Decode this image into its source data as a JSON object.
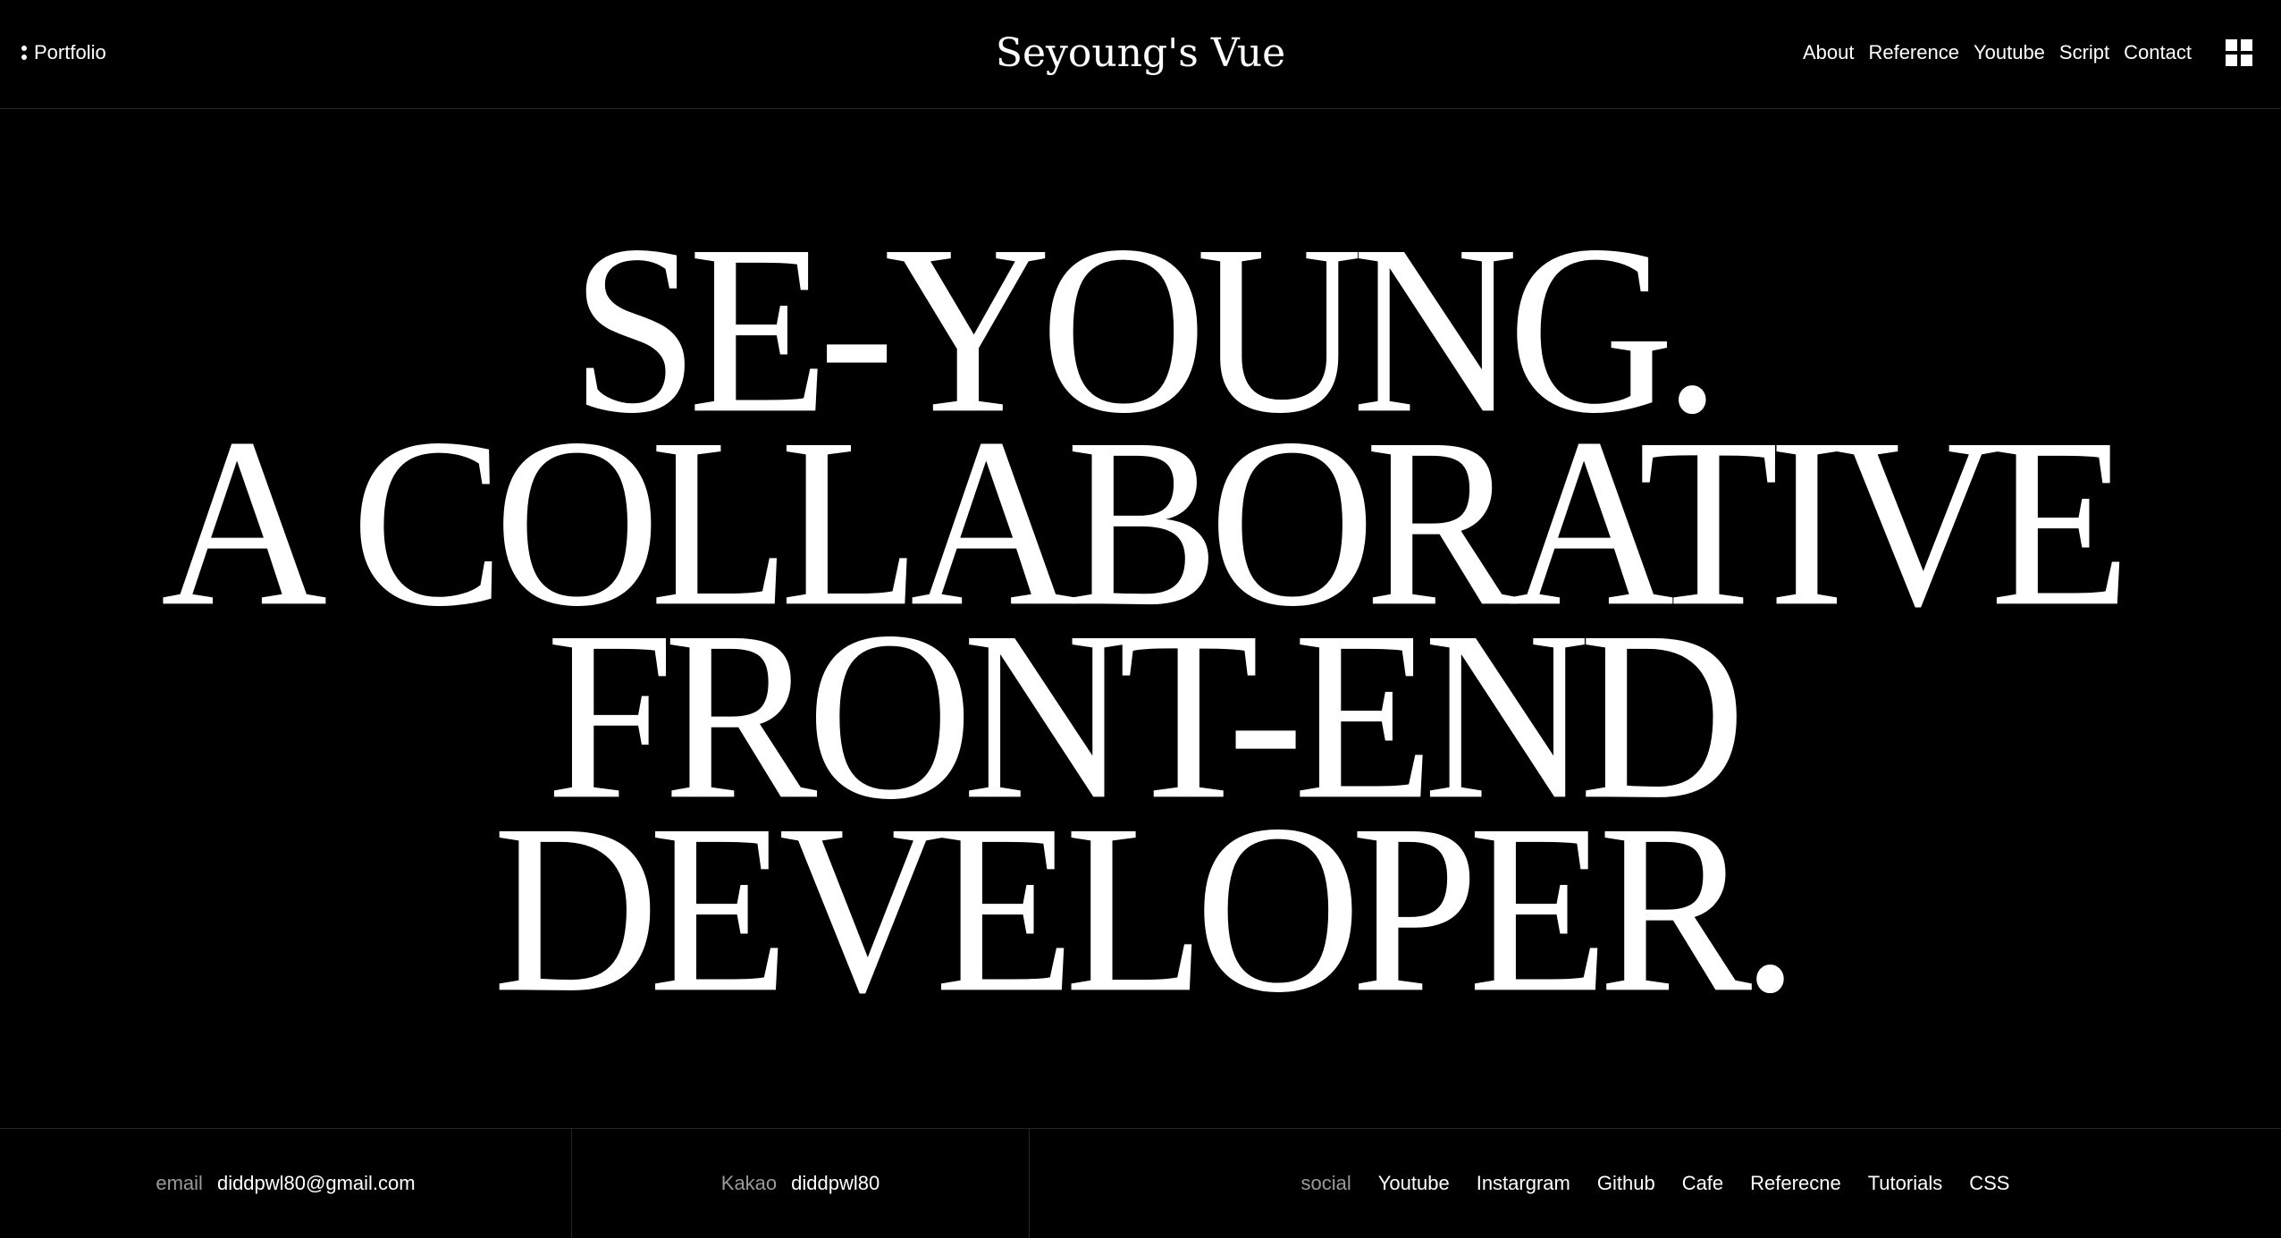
{
  "header": {
    "logo_label": "Portfolio",
    "site_title": "Seyoung's Vue",
    "nav": [
      {
        "label": "About"
      },
      {
        "label": "Reference"
      },
      {
        "label": "Youtube"
      },
      {
        "label": "Script"
      },
      {
        "label": "Contact"
      }
    ],
    "menu_icon": "grid-icon"
  },
  "hero": {
    "lines": [
      "SE-YOUNG.",
      "A COLLABORATIVE",
      "FRONT-END",
      "DEVELOPER."
    ]
  },
  "footer": {
    "email": {
      "label": "email",
      "value": "diddpwl80@gmail.com"
    },
    "kakao": {
      "label": "Kakao",
      "value": "diddpwl80"
    },
    "social": {
      "label": "social",
      "links": [
        "Youtube",
        "Instargram",
        "Github",
        "Cafe",
        "Referecne",
        "Tutorials",
        "CSS"
      ]
    }
  },
  "colors": {
    "background": "#000000",
    "text": "#ffffff",
    "muted": "#9a9a9a",
    "divider": "#262626"
  }
}
